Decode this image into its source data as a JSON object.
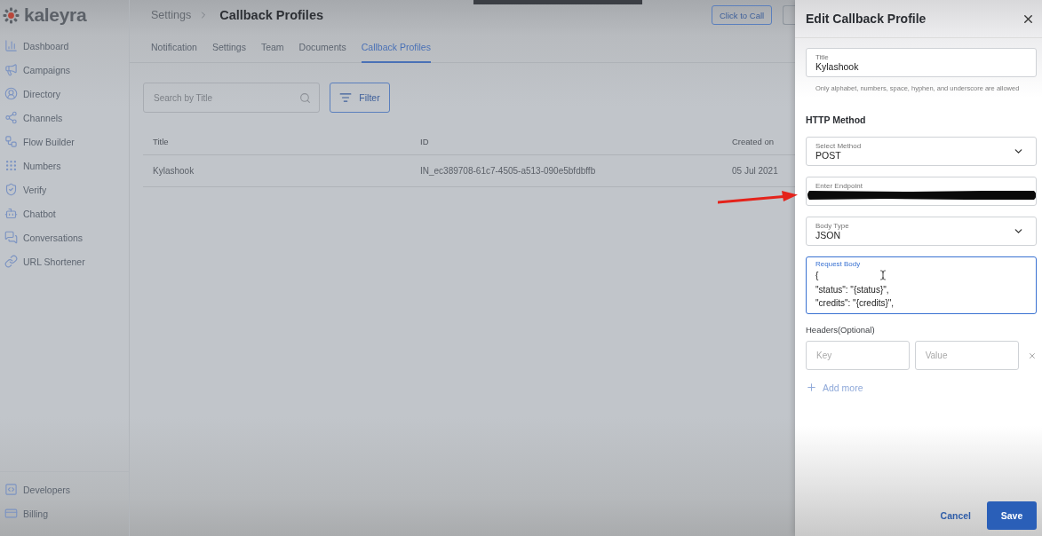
{
  "logo": {
    "text": "kaleyra"
  },
  "sidebar": {
    "items": [
      "Dashboard",
      "Campaigns",
      "Directory",
      "Channels",
      "Flow Builder",
      "Numbers",
      "Verify",
      "Chatbot",
      "Conversations",
      "URL Shortener"
    ],
    "footer_items": [
      "Developers",
      "Billing"
    ]
  },
  "breadcrumb": {
    "parent": "Settings",
    "current": "Callback Profiles"
  },
  "header_buttons": [
    "Click to Call"
  ],
  "tabs": [
    {
      "label": "Notification",
      "selected": false
    },
    {
      "label": "Settings",
      "selected": false
    },
    {
      "label": "Team",
      "selected": false
    },
    {
      "label": "Documents",
      "selected": false
    },
    {
      "label": "Callback Profiles",
      "selected": true
    }
  ],
  "search": {
    "placeholder": "Search by Title"
  },
  "filter_button": {
    "label": "Filter"
  },
  "table": {
    "columns": [
      "Title",
      "ID",
      "Created on"
    ],
    "rows": [
      [
        "Kylashook",
        "IN_ec389708-61c7-4505-a513-090e5bfdbffb",
        "05 Jul 2021"
      ]
    ]
  },
  "drawer": {
    "title": "Edit Callback Profile",
    "title_field": {
      "label": "Title",
      "value": "Kylashook",
      "hint": "Only alphabet, numbers, space, hyphen, and underscore are allowed"
    },
    "section_heading": "HTTP Method",
    "fields": [
      {
        "kind": "select",
        "label": "Select Method",
        "value": "POST"
      },
      {
        "kind": "text",
        "label": "Enter Endpoint",
        "redacted": true
      },
      {
        "kind": "select",
        "label": "Body Type",
        "value": "JSON"
      },
      {
        "kind": "textarea",
        "label": "Request Body",
        "focused": true,
        "lines": [
          "{",
          "\"status\": \"{status}\",",
          "\"credits\": \"{credits}\","
        ]
      }
    ],
    "headers": {
      "label": "Headers(Optional)",
      "key_placeholder": "Key",
      "value_placeholder": "Value"
    },
    "add_more": "Add more",
    "buttons": [
      {
        "kind": "text",
        "label": "Cancel"
      },
      {
        "kind": "primary",
        "label": "Save"
      }
    ]
  },
  "annotation": {
    "kind": "arrow"
  }
}
